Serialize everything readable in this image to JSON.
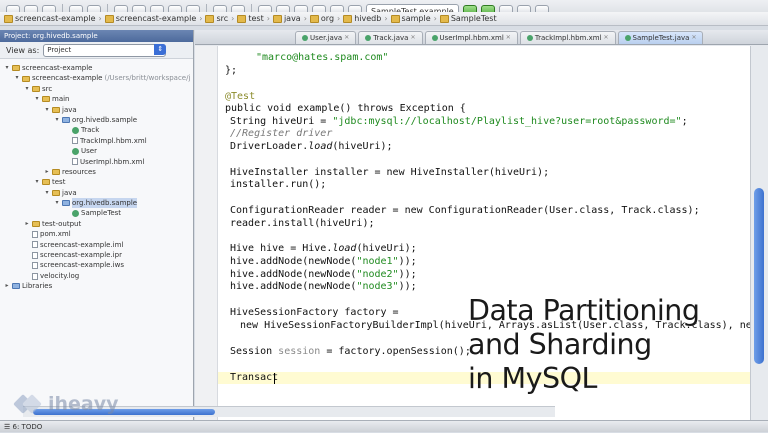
{
  "toolbar": {
    "config_combo": "SampleTest.example"
  },
  "breadcrumbs": [
    "screencast-example",
    "screencast-example",
    "src",
    "test",
    "java",
    "org",
    "hivedb",
    "sample",
    "SampleTest"
  ],
  "left_panel": {
    "header": "Project: org.hivedb.sample",
    "view_as_label": "View as:",
    "view_as_value": "Project",
    "tree": [
      {
        "label": "screencast-example",
        "level": 0,
        "icon": "folder-icon",
        "toggle": "▾"
      },
      {
        "label": "screencast-example",
        "path": "(/Users/britt/workspace/j",
        "level": 1,
        "icon": "folder-icon",
        "toggle": "▾"
      },
      {
        "label": "src",
        "level": 2,
        "icon": "folder-icon",
        "toggle": "▾"
      },
      {
        "label": "main",
        "level": 3,
        "icon": "folder-icon",
        "toggle": "▾"
      },
      {
        "label": "java",
        "level": 4,
        "icon": "folder-icon",
        "toggle": "▾"
      },
      {
        "label": "org.hivedb.sample",
        "level": 5,
        "icon": "package-icon",
        "toggle": "▾"
      },
      {
        "label": "Track",
        "level": 6,
        "icon": "class-icon",
        "toggle": ""
      },
      {
        "label": "TrackImpl.hbm.xml",
        "level": 6,
        "icon": "file-icon",
        "toggle": ""
      },
      {
        "label": "User",
        "level": 6,
        "icon": "class-icon",
        "toggle": ""
      },
      {
        "label": "UserImpl.hbm.xml",
        "level": 6,
        "icon": "file-icon",
        "toggle": ""
      },
      {
        "label": "resources",
        "level": 4,
        "icon": "folder-icon",
        "toggle": "▸"
      },
      {
        "label": "test",
        "level": 3,
        "icon": "folder-icon",
        "toggle": "▾"
      },
      {
        "label": "java",
        "level": 4,
        "icon": "folder-icon",
        "toggle": "▾"
      },
      {
        "label": "org.hivedb.sample",
        "level": 5,
        "icon": "package-icon",
        "toggle": "▾",
        "selected": true
      },
      {
        "label": "SampleTest",
        "level": 6,
        "icon": "class-icon",
        "toggle": ""
      },
      {
        "label": "test-output",
        "level": 2,
        "icon": "folder-icon",
        "toggle": "▸"
      },
      {
        "label": "pom.xml",
        "level": 2,
        "icon": "file-icon",
        "toggle": ""
      },
      {
        "label": "screencast-example.iml",
        "level": 2,
        "icon": "file-icon",
        "toggle": ""
      },
      {
        "label": "screencast-example.ipr",
        "level": 2,
        "icon": "file-icon",
        "toggle": ""
      },
      {
        "label": "screencast-example.iws",
        "level": 2,
        "icon": "file-icon",
        "toggle": ""
      },
      {
        "label": "velocity.log",
        "level": 2,
        "icon": "file-icon",
        "toggle": ""
      },
      {
        "label": "Libraries",
        "level": 0,
        "icon": "library-icon",
        "toggle": "▸"
      }
    ]
  },
  "editor": {
    "tabs": [
      {
        "label": "User.java",
        "active": false
      },
      {
        "label": "Track.java",
        "active": false
      },
      {
        "label": "UserImpl.hbm.xml",
        "active": false
      },
      {
        "label": "TrackImpl.hbm.xml",
        "active": false
      },
      {
        "label": "SampleTest.java",
        "active": true
      }
    ],
    "code": {
      "l1": "\"marco@hates.spam.com\"",
      "l2": "};",
      "l3": "@Test",
      "l4": "public void example() throws Exception {",
      "l5a": "String hiveUri = ",
      "l5b": "\"jdbc:mysql://localhost/Playlist_hive?user=root&password=\"",
      "l5c": ";",
      "l6": "//Register driver",
      "l7a": "DriverLoader.",
      "l7b": "load",
      "l7c": "(hiveUri);",
      "l8": "HiveInstaller installer = new HiveInstaller(hiveUri);",
      "l9": "installer.run();",
      "l10": "ConfigurationReader reader = new ConfigurationReader(User.class, Track.class);",
      "l11": "reader.install(hiveUri);",
      "l12a": "Hive hive = Hive.",
      "l12b": "load",
      "l12c": "(hiveUri);",
      "l13a": "hive.addNode(newNode(",
      "l13b": "\"node1\"",
      "l13c": "));",
      "l14b": "\"node2\"",
      "l15b": "\"node3\"",
      "l16": "HiveSessionFactory factory =",
      "l17": "new HiveSessionFactoryBuilderImpl(hiveUri, Arrays.asList(User.class, Track.class), new Se",
      "l18a": "Session ",
      "l18b": "session",
      "l18c": " = factory.openSession();",
      "l19": "Transact"
    }
  },
  "status": {
    "text": "☰ 6: TODO"
  },
  "overlay": {
    "line1": "Data Partitioning",
    "line2": "and Sharding",
    "line3": "in MySQL"
  },
  "logo": {
    "text": "iheavy"
  }
}
